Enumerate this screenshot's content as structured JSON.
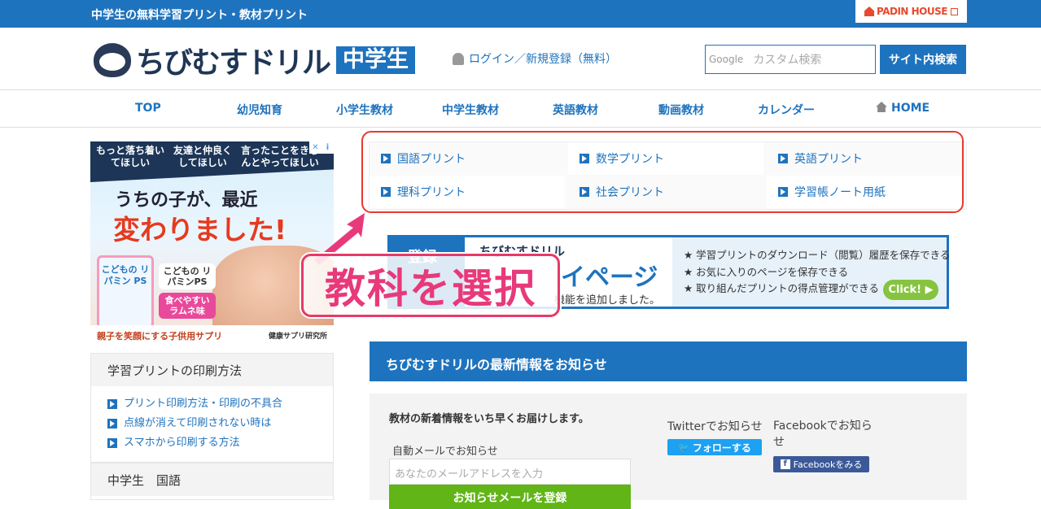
{
  "topbar": {
    "tagline": "中学生の無料学習プリント・教材プリント",
    "partner": "PADIN HOUSE"
  },
  "header": {
    "logo_text": "ちびむすドリル",
    "logo_badge": "中学生",
    "login": "ログイン／新規登録（無料）",
    "search_brand": "Google",
    "search_placeholder": "カスタム検索",
    "search_button": "サイト内検索"
  },
  "nav": [
    {
      "label": "TOP"
    },
    {
      "label": "幼児知育"
    },
    {
      "label": "小学生教材"
    },
    {
      "label": "中学生教材"
    },
    {
      "label": "英語教材"
    },
    {
      "label": "動画教材"
    },
    {
      "label": "カレンダー"
    },
    {
      "label": "HOME"
    }
  ],
  "ad": {
    "bubbles": [
      "もっと落ち着いてほしい",
      "友達と仲良くしてほしい",
      "言ったことをきちんとやってほしい"
    ],
    "headline1": "うちの子が、最近",
    "headline2": "変わりました!",
    "pack": "こどもの リパミン PS",
    "caption1": "こどもの リパミンPS",
    "caption2": "食べやすい ラムネ味",
    "footer": "親子を笑顔にする子供用サプリ",
    "maker": "健康サプリ研究所"
  },
  "sidebar": [
    {
      "title": "学習プリントの印刷方法",
      "items": [
        "プリント印刷方法・印刷の不具合",
        "点線が消えて印刷されない時は",
        "スマホから印刷する方法"
      ]
    },
    {
      "title": "中学生　国語",
      "items": []
    }
  ],
  "subjects": [
    "国語プリント",
    "数学プリント",
    "英語プリント",
    "理科プリント",
    "社会プリント",
    "学習帳ノート用紙"
  ],
  "mypage": {
    "left": "登録",
    "brand": "ちびむすドリル",
    "big": "イページ",
    "small": "機能を追加しました。",
    "features": [
      "★ 学習プリントのダウンロード（閲覧）履歴を保存できる",
      "★ お気に入りのページを保存できる",
      "★ 取り組んだプリントの得点管理ができる"
    ],
    "click": "Click! ▶"
  },
  "overlay": "教科を選択",
  "news": {
    "title": "ちびむすドリルの最新情報をお知らせ",
    "lead": "教材の新着情報をいち早くお届けします。",
    "mail_label": "自動メールでお知らせ",
    "mail_placeholder": "あなたのメールアドレスを入力",
    "mail_button": "お知らせメールを登録",
    "twitter_label": "Twitterでお知らせ",
    "twitter_button": "フォローする",
    "facebook_label": "Facebookでお知らせ",
    "facebook_button": "Facebookをみる"
  }
}
